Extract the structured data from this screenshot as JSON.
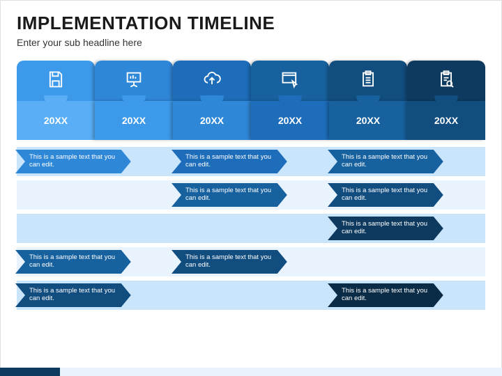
{
  "title": "IMPLEMENTATION TIMELINE",
  "subtitle": "Enter your sub headline here",
  "colors": {
    "tabs": [
      "#3d99ea",
      "#2f87d8",
      "#1d6dbb",
      "#17619f",
      "#124d7f",
      "#0e3a5f"
    ],
    "years": [
      "#59aef5",
      "#3d99ea",
      "#2f87d8",
      "#1d6dbb",
      "#17619f",
      "#124d7f"
    ],
    "arrows": [
      "#2f87d8",
      "#1d6dbb",
      "#17619f",
      "#124d7f",
      "#0e3a5f",
      "#0a2c47"
    ]
  },
  "icons": [
    "save-icon",
    "presentation-icon",
    "cloud-upload-icon",
    "window-cursor-icon",
    "clipboard-icon",
    "clipboard-search-icon"
  ],
  "years": [
    "20XX",
    "20XX",
    "20XX",
    "20XX",
    "20XX",
    "20XX"
  ],
  "sample": "This is a sample text that you can edit.",
  "rows": [
    {
      "bg": "even",
      "items": [
        {
          "col": 0,
          "c": 0
        },
        {
          "col": 2,
          "c": 1
        },
        {
          "col": 4,
          "c": 2
        }
      ]
    },
    {
      "bg": "odd",
      "items": [
        {
          "col": 2,
          "c": 2
        },
        {
          "col": 4,
          "c": 3
        }
      ]
    },
    {
      "bg": "even",
      "items": [
        {
          "col": 4,
          "c": 4
        }
      ]
    },
    {
      "bg": "odd",
      "items": [
        {
          "col": 0,
          "c": 2
        },
        {
          "col": 2,
          "c": 3
        }
      ]
    },
    {
      "bg": "even",
      "items": [
        {
          "col": 0,
          "c": 3
        },
        {
          "col": 4,
          "c": 5
        }
      ]
    }
  ],
  "bottom": [
    {
      "c": "#0e3a5f",
      "w": "12%"
    },
    {
      "c": "#e8f3fd",
      "w": "88%"
    }
  ]
}
